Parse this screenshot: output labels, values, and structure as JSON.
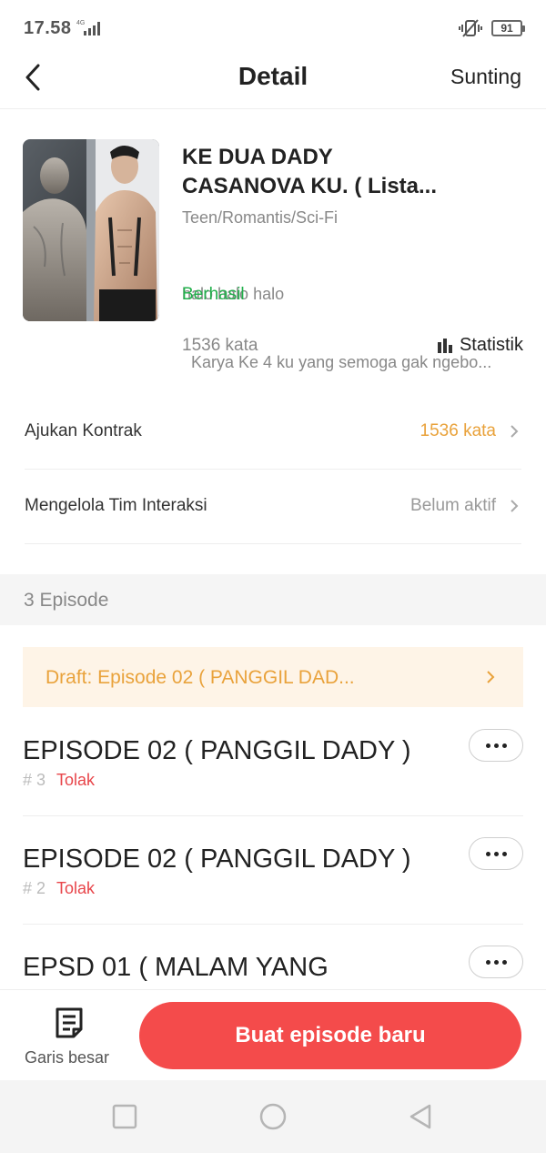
{
  "status_bar": {
    "time": "17.58",
    "network": "4G",
    "battery": "91"
  },
  "header": {
    "title": "Detail",
    "edit_label": "Sunting"
  },
  "book": {
    "title_line1": "KE DUA DADY",
    "title_line2": "CASANOVA KU. ( Lista...",
    "genre": "Teen/Romantis/Sci-Fi",
    "desc_line1": "halo halo halo",
    "desc_line2": "  Karya Ke 4 ku yang semoga gak ngebo...",
    "status": "Berhasil",
    "word_count": "1536 kata",
    "stats_label": "Statistik"
  },
  "rows": [
    {
      "label": "Ajukan Kontrak",
      "value": "1536 kata",
      "value_color": "#e9a23b"
    },
    {
      "label": "Mengelola Tim Interaksi",
      "value": "Belum aktif",
      "value_color": "#999999"
    }
  ],
  "episodes": {
    "count_label": "3 Episode",
    "draft_label": "Draft: Episode 02 ( PANGGIL DAD...",
    "items": [
      {
        "title": "EPISODE 02 ( PANGGIL DADY )",
        "number": "# 3",
        "status": "Tolak"
      },
      {
        "title": "EPISODE 02 ( PANGGIL DADY )",
        "number": "# 2",
        "status": "Tolak"
      },
      {
        "title": "EPSD 01 ( MALAM YANG",
        "number": "",
        "status": ""
      }
    ]
  },
  "bottom_bar": {
    "outline_label": "Garis besar",
    "new_episode_label": "Buat episode baru"
  },
  "colors": {
    "accent_red": "#f44b4b",
    "success_green": "#21b04b",
    "warning_orange": "#e9a23b",
    "reject_red": "#e8454a"
  },
  "icons": [
    "back-icon",
    "stats-icon",
    "chevron-right-icon",
    "more-icon",
    "outline-icon",
    "nav-recent-icon",
    "nav-home-icon",
    "nav-back-icon"
  ]
}
